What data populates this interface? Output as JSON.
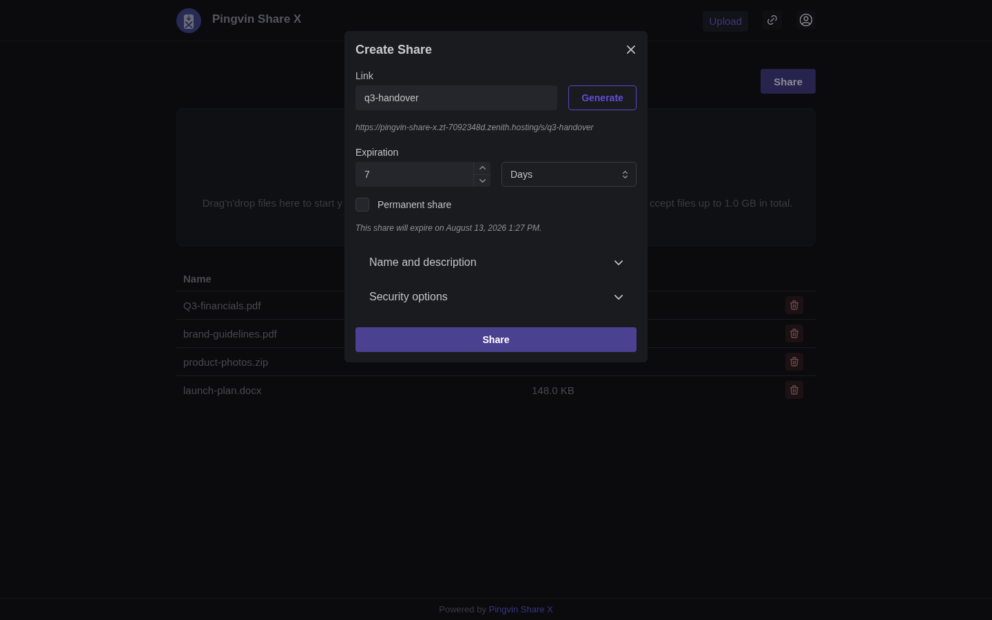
{
  "header": {
    "title": "Pingvin Share X",
    "upload_button": "Upload"
  },
  "toolbar": {
    "share_button": "Share"
  },
  "dropzone": {
    "hint_fragments": [
      "Drag'n'drop files here to start y",
      "ccept files up to 1.0 GB in total."
    ]
  },
  "table": {
    "columns": [
      "Name"
    ],
    "rows": [
      {
        "name": "Q3-financials.pdf"
      },
      {
        "name": "brand-guidelines.pdf"
      },
      {
        "name": "product-photos.zip"
      },
      {
        "name": "launch-plan.docx",
        "size": "148.0 KB"
      }
    ]
  },
  "dialog": {
    "title": "Create Share",
    "link": {
      "label": "Link",
      "value": "q3-handover",
      "button": "Generate"
    },
    "share_url": "https://pingvin-share-x.zt-7092348d.zenith.hosting/s/q3-handover",
    "expiration": {
      "label": "Expiration",
      "value": "7",
      "unit": "Days"
    },
    "permanent": {
      "label": "Permanent share",
      "checked": false
    },
    "expiry_note": "This share will expire on August 13, 2026 1:27 PM.",
    "sections": [
      {
        "label": "Name and description",
        "expanded": false
      },
      {
        "label": "Security options",
        "expanded": false
      }
    ],
    "submit": "Share"
  },
  "footer": {
    "text": "Powered by",
    "link": "Pingvin Share X"
  }
}
